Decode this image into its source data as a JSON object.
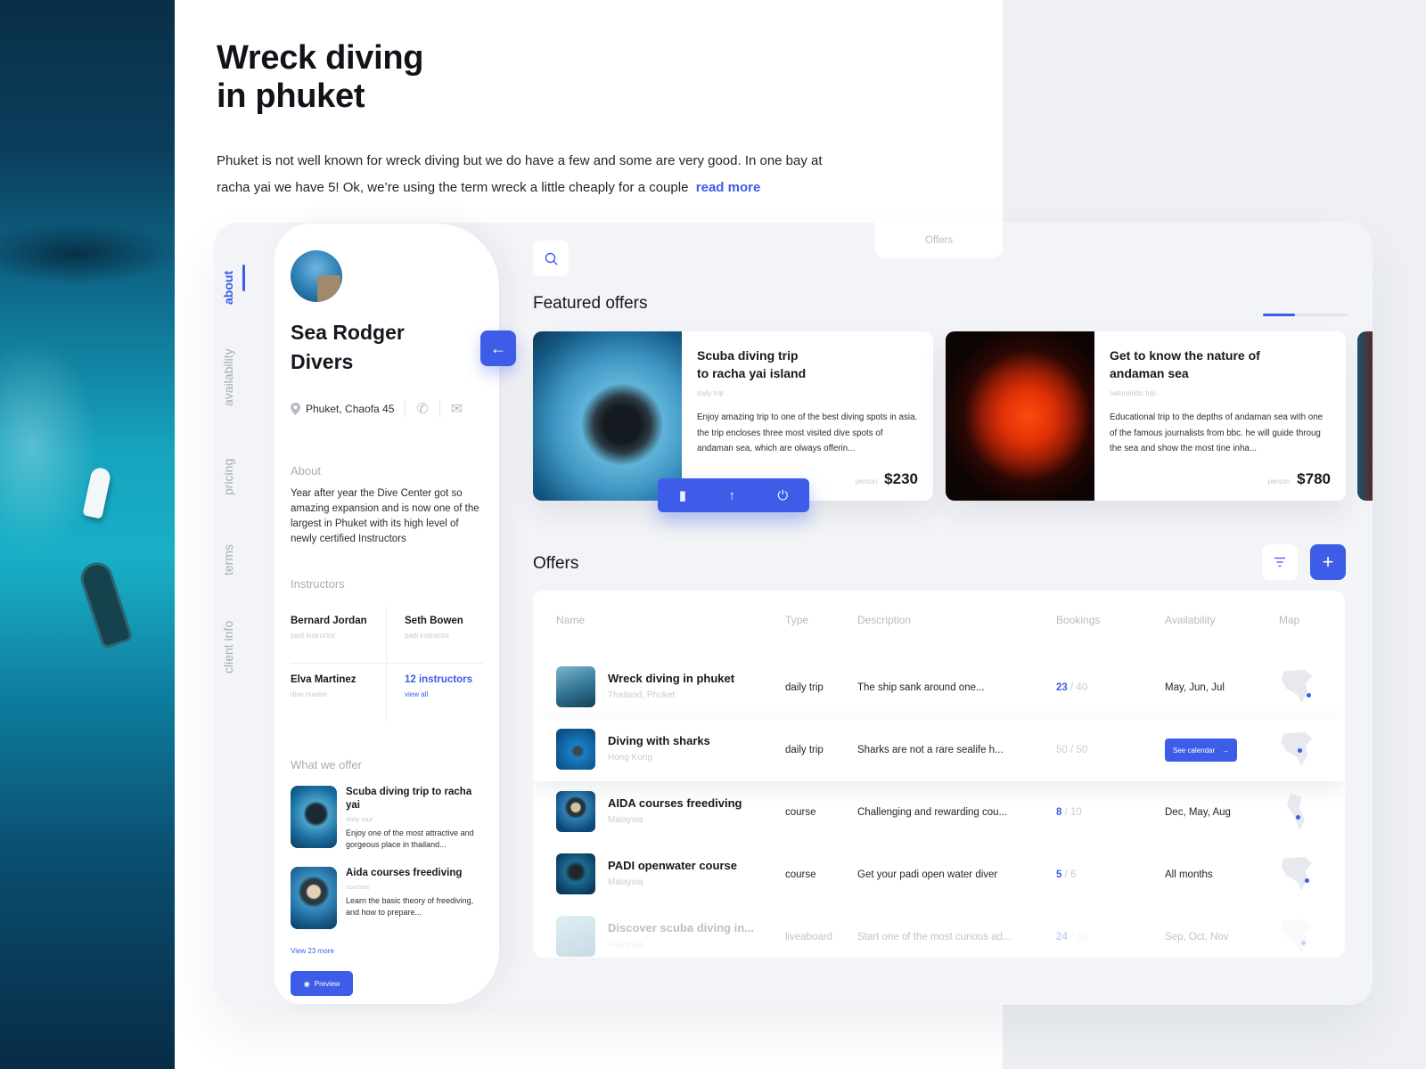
{
  "hero": {
    "title_line1": "Wreck diving",
    "title_line2": "in phuket",
    "text": "Phuket is not well known for wreck diving but we do have a few and some are very good. In one bay at racha yai we have 5! Ok, we’re using the term wreck a little cheaply for a couple",
    "read_more": "read more"
  },
  "vnav": [
    {
      "label": "about",
      "active": true
    },
    {
      "label": "availability",
      "active": false
    },
    {
      "label": "pricing",
      "active": false
    },
    {
      "label": "terms",
      "active": false
    },
    {
      "label": "client info",
      "active": false
    }
  ],
  "profile": {
    "name_line1": "Sea Rodger",
    "name_line2": "Divers",
    "location": "Phuket, Chaofa 45",
    "about_label": "About",
    "about_text": "Year after year the Dive Center got so amazing expansion and is now one of the largest in Phuket with its high level of newly certified Instructors",
    "instructors_label": "Instructors",
    "instructors": [
      {
        "name": "Bernard Jordan",
        "role": "padi instructor"
      },
      {
        "name": "Seth Bowen",
        "role": "padi instructor"
      },
      {
        "name": "Elva Martinez",
        "role": "dive master"
      }
    ],
    "instructors_link": "12 instructors",
    "instructors_view_all": "view all",
    "offer_label": "What we offer",
    "offers": [
      {
        "title": "Scuba diving trip to racha yai",
        "type": "daily tour",
        "desc": "Enjoy one of the most attractive and gorgeous place in thailand..."
      },
      {
        "title": "Aida courses freediving",
        "type": "courses",
        "desc": "Learn the basic theory of freediving, and how to prepare..."
      }
    ],
    "view_more": "View 23 more",
    "preview": "Preview"
  },
  "tabs": {
    "offers": "Offers"
  },
  "featured": {
    "heading": "Featured offers",
    "cards": [
      {
        "title_line1": "Scuba diving trip",
        "title_line2": "to racha yai island",
        "type": "daily trip",
        "desc": "Enjoy amazing trip to one of the best diving spots in asia. the trip encloses three most visited dive spots of andaman sea, which are olways offerin...",
        "price_label": "person",
        "price": "$230"
      },
      {
        "title_line1": "Get to know the nature of",
        "title_line2": "andaman sea",
        "type": "naturalistic trip",
        "desc": "Educational trip to the depths of andaman sea with one of the famous journalists from bbc. he will guide throug the sea and show the most tine inha...",
        "price_label": "person",
        "price": "$780"
      }
    ]
  },
  "offers": {
    "heading": "Offers",
    "columns": [
      "Name",
      "Type",
      "Description",
      "Bookings",
      "Availability",
      "Map"
    ],
    "rows": [
      {
        "name": "Wreck diving in phuket",
        "place": "Thailand, Phuket",
        "type": "daily trip",
        "desc": "The ship sank around one...",
        "booked": "23",
        "total": "40",
        "availability": "May, Jun, Jul"
      },
      {
        "name": "Diving with sharks",
        "place": "Hong Kong",
        "type": "daily trip",
        "desc": "Sharks are not a rare sealife h...",
        "booked": "50",
        "total": "50",
        "availability": "See calendar"
      },
      {
        "name": "AIDA courses freediving",
        "place": "Malaysia",
        "type": "course",
        "desc": "Challenging and rewarding cou...",
        "booked": "8",
        "total": "10",
        "availability": "Dec, May, Aug"
      },
      {
        "name": "PADI openwater course",
        "place": "Malaysia",
        "type": "course",
        "desc": "Get your padi open water diver",
        "booked": "5",
        "total": "6",
        "availability": "All months"
      },
      {
        "name": "Discover scuba diving in...",
        "place": "Malaysia",
        "type": "liveaboard",
        "desc": "Start one of the most curious ad...",
        "booked": "24",
        "total": "30",
        "availability": "Sep, Oct, Nov"
      }
    ]
  },
  "colors": {
    "accent": "#3d5ce8",
    "text": "#16181f",
    "muted": "#a7acb8",
    "bg": "#eef0f4"
  }
}
